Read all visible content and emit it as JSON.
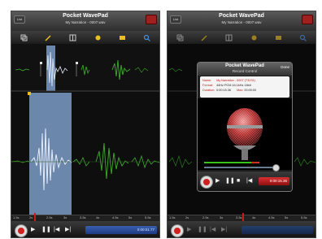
{
  "app": {
    "title": "Pocket WavePad",
    "file": "My Narration - 0007.wav",
    "list_label": "List"
  },
  "toolbar": {
    "icons": [
      "copy-icon",
      "edit-wand-icon",
      "trim-icon",
      "effects-icon",
      "open-file-icon",
      "zoom-icon"
    ]
  },
  "ruler": {
    "ticks": [
      "1.5s",
      "2s",
      "2.5s",
      "3s",
      "3.5s",
      "4s",
      "4.5s",
      "5s",
      "5.5s"
    ]
  },
  "left_device": {
    "time": "0:00:01.77"
  },
  "record_dialog": {
    "title": "Pocket WavePad",
    "subtitle": "Record Control",
    "done_label": "Done",
    "info": [
      {
        "key": "Name:",
        "value": "My Narration - 0007 (T3231)"
      },
      {
        "key": "Format:",
        "value": "44Hz PCM 44.1kHz 16bit"
      },
      {
        "key": "Duration:",
        "value": "0:00:15.36",
        "extra_key": "Max:",
        "extra_value": "00:00:00"
      }
    ],
    "record_time": "0:00:15.36"
  },
  "colors": {
    "selection": "#7d9cc8",
    "waveform": "#3fae2c",
    "record_red": "#d02020",
    "time_blue": "#2a4c9c"
  }
}
